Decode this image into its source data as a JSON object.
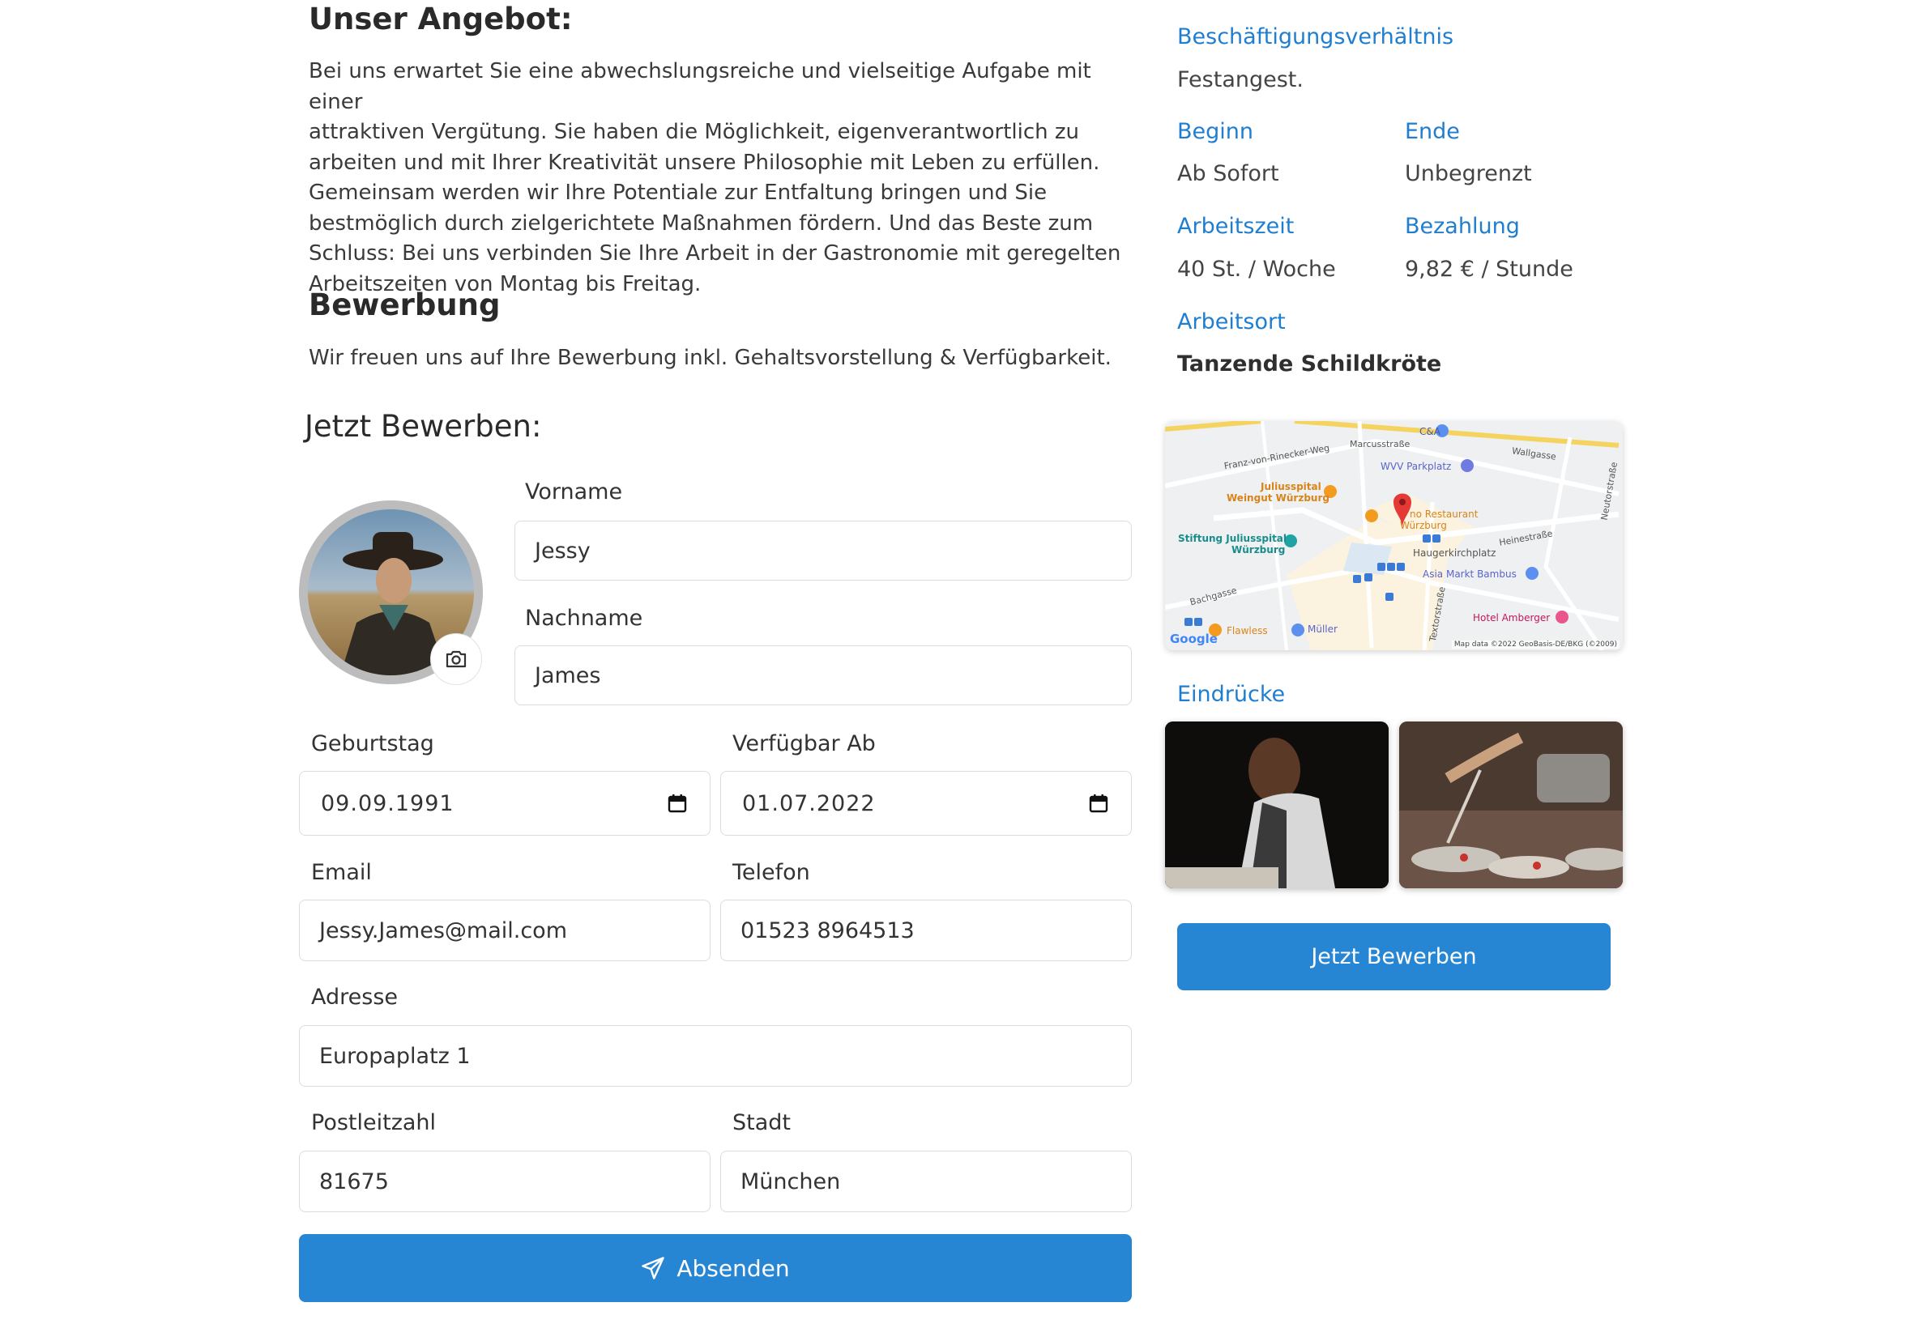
{
  "offer": {
    "heading": "Unser Angebot:",
    "lines": [
      "Bei uns erwartet Sie eine abwechslungsreiche und vielseitige Aufgabe mit einer",
      "attraktiven Vergütung. Sie haben die Möglichkeit, eigenverantwortlich zu",
      "arbeiten und mit Ihrer Kreativität unsere Philosophie mit Leben zu erfüllen.",
      "Gemeinsam werden wir Ihre Potentiale zur Entfaltung bringen und Sie",
      "bestmöglich durch zielgerichtete Maßnahmen fördern. Und das Beste zum",
      "Schluss: Bei uns verbinden Sie Ihre Arbeit in der Gastronomie mit geregelten",
      "Arbeitszeiten von Montag bis Freitag."
    ]
  },
  "application": {
    "heading": "Bewerbung",
    "text": "Wir freuen uns auf Ihre Bewerbung inkl. Gehaltsvorstellung & Verfügbarkeit."
  },
  "form": {
    "heading": "Jetzt Bewerben:",
    "first_name": {
      "label": "Vorname",
      "value": "Jessy"
    },
    "last_name": {
      "label": "Nachname",
      "value": "James"
    },
    "birthday": {
      "label": "Geburtstag",
      "value": "09.09.1991"
    },
    "available_from": {
      "label": "Verfügbar Ab",
      "value": "01.07.2022"
    },
    "email": {
      "label": "Email",
      "value": "Jessy.James@mail.com"
    },
    "phone": {
      "label": "Telefon",
      "value": "01523 8964513"
    },
    "address": {
      "label": "Adresse",
      "value": "Europaplatz 1"
    },
    "zip": {
      "label": "Postleitzahl",
      "value": "81675"
    },
    "city": {
      "label": "Stadt",
      "value": "München"
    },
    "submit_label": "Absenden",
    "avatar_icon": "camera-icon",
    "submit_icon": "paper-plane-icon"
  },
  "sidebar": {
    "employment": {
      "label": "Beschäftigungsverhältnis",
      "value": "Festangest."
    },
    "start": {
      "label": "Beginn",
      "value": "Ab Sofort"
    },
    "end": {
      "label": "Ende",
      "value": "Unbegrenzt"
    },
    "hours": {
      "label": "Arbeitszeit",
      "value": "40 St. / Woche"
    },
    "pay": {
      "label": "Bezahlung",
      "value": "9,82 € / Stunde"
    },
    "location": {
      "label": "Arbeitsort",
      "value": "Tanzende Schildkröte"
    },
    "map": {
      "labels": {
        "ca": "C&A",
        "marcus": "Marcusstraße",
        "franz": "Franz-von-Rinecker-Weg",
        "wallgasse": "Wallgasse",
        "wvv": "WVV Parkplatz",
        "juliusspital1": "Juliusspital",
        "juliusspital2": "Weingut Würzburg",
        "restaurant1": "no Restaurant",
        "restaurant2": "Würzburg",
        "neutor": "Neutorstraße",
        "stiftung1": "Stiftung Juliusspital",
        "stiftung2": "Würzburg",
        "heine": "Heinestraße",
        "haugerkirch": "Haugerkirchplatz",
        "asia": "Asia Markt Bambus",
        "bach": "Bachgasse",
        "textor": "Textorstraße",
        "hotel": "Hotel Amberger",
        "flawless": "Flawless",
        "mueller": "Müller",
        "google": "Google",
        "attribution": "Map data ©2022 GeoBasis-DE/BKG (©2009)"
      }
    },
    "impressions_label": "Eindrücke",
    "apply_label": "Jetzt Bewerben"
  },
  "colors": {
    "accent": "#2786d4",
    "link": "#1f7ed0"
  }
}
